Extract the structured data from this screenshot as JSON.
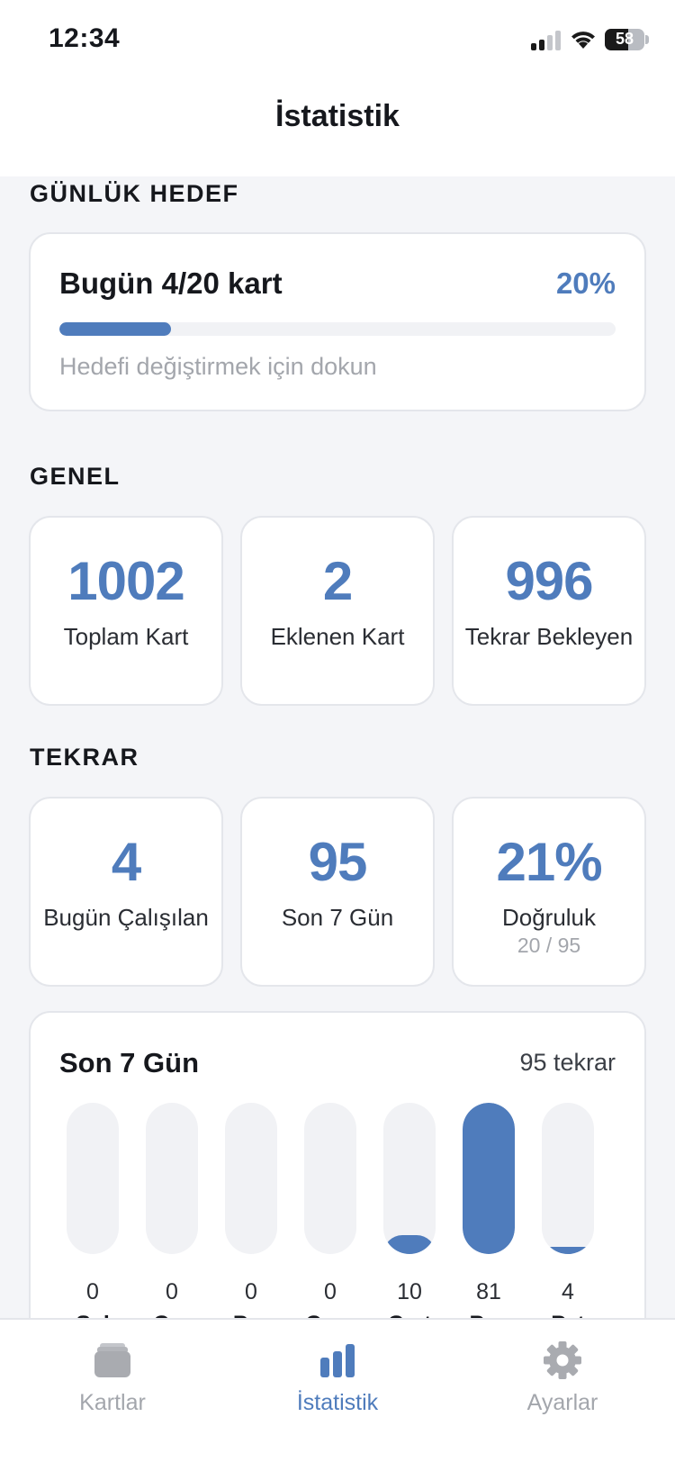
{
  "status_bar": {
    "time": "12:34",
    "battery": "58",
    "battery_level": 0.58
  },
  "header": {
    "title": "İstatistik"
  },
  "daily_goal": {
    "section_title": "GÜNLÜK HEDEF",
    "title": "Bugün 4/20 kart",
    "percent_label": "20%",
    "progress": 0.2,
    "hint": "Hedefi değiştirmek için dokun"
  },
  "general": {
    "section_title": "GENEL",
    "stats": [
      {
        "value": "1002",
        "label": "Toplam Kart"
      },
      {
        "value": "2",
        "label": "Eklenen Kart"
      },
      {
        "value": "996",
        "label": "Tekrar Bekleyen"
      }
    ]
  },
  "review": {
    "section_title": "TEKRAR",
    "stats": [
      {
        "value": "4",
        "label": "Bugün Çalışılan"
      },
      {
        "value": "95",
        "label": "Son 7 Gün"
      },
      {
        "value": "21%",
        "label": "Doğruluk",
        "sub": "20 / 95"
      }
    ]
  },
  "last7": {
    "title": "Son 7 Gün",
    "total_label": "95 tekrar",
    "max": 81,
    "days": [
      {
        "day": "Sal",
        "count": 0
      },
      {
        "day": "Car",
        "count": 0
      },
      {
        "day": "Per",
        "count": 0
      },
      {
        "day": "Cum",
        "count": 0
      },
      {
        "day": "Cmt",
        "count": 10
      },
      {
        "day": "Paz",
        "count": 81
      },
      {
        "day": "Pzt",
        "count": 4
      }
    ]
  },
  "tab_bar": {
    "items": [
      {
        "label": "Kartlar",
        "icon": "cards-icon",
        "active": false
      },
      {
        "label": "İstatistik",
        "icon": "bar-chart-icon",
        "active": true
      },
      {
        "label": "Ayarlar",
        "icon": "gear-icon",
        "active": false
      }
    ]
  },
  "colors": {
    "accent": "#4f7cbc",
    "muted": "#a3a6ac",
    "track": "#f1f2f5",
    "inactive_icon": "#a9abb0"
  }
}
